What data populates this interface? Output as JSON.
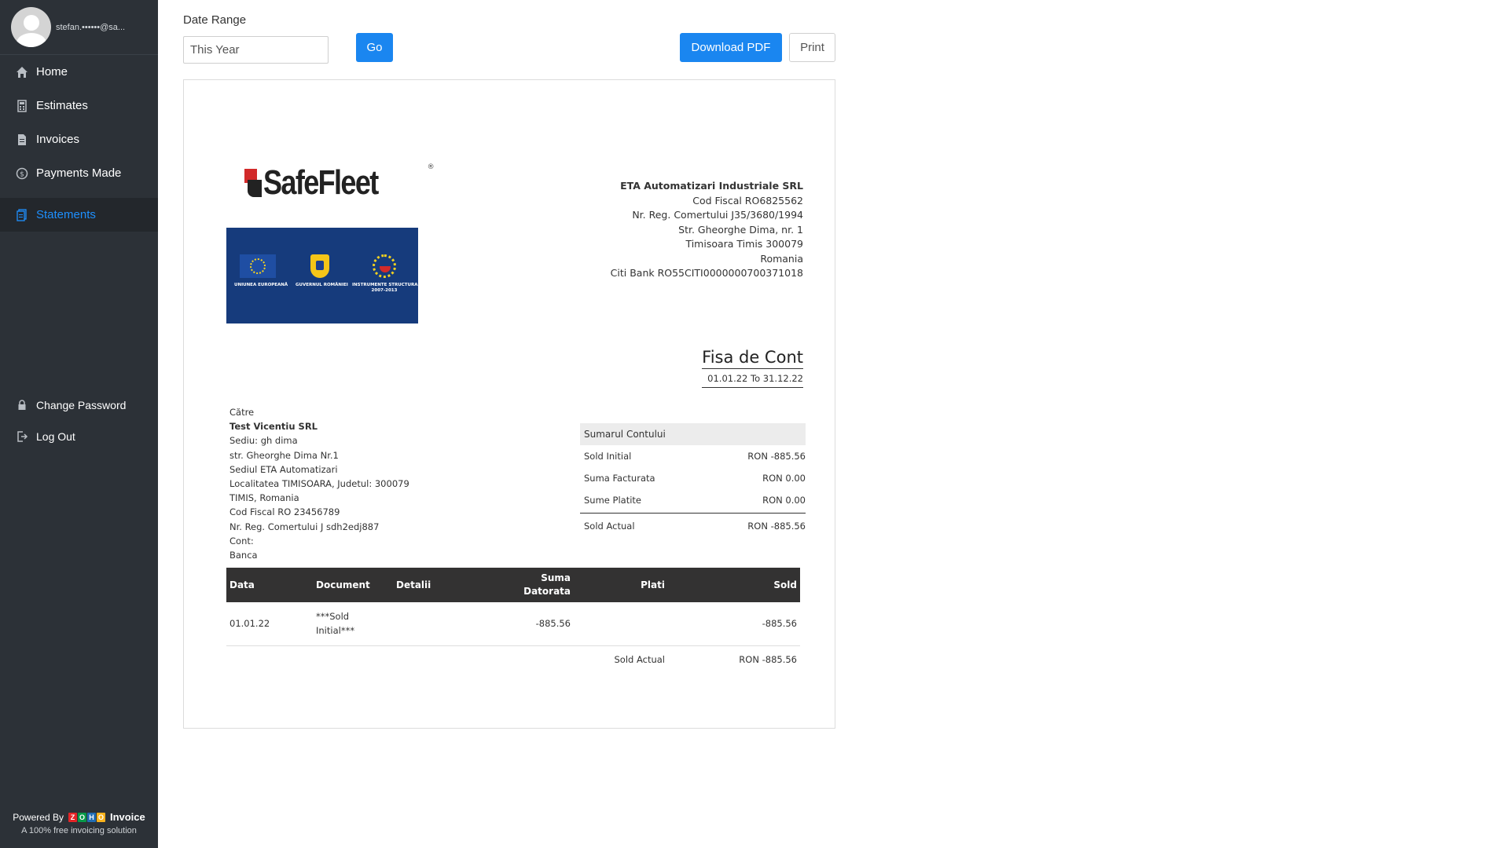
{
  "sidebar": {
    "email": "stefan.••••••@sa...",
    "nav": [
      {
        "label": "Home",
        "icon": "home-icon"
      },
      {
        "label": "Estimates",
        "icon": "calculator-icon"
      },
      {
        "label": "Invoices",
        "icon": "document-icon"
      },
      {
        "label": "Payments Made",
        "icon": "dollar-circle-icon"
      },
      {
        "label": "Statements",
        "icon": "statement-icon",
        "active": true
      }
    ],
    "bottom_nav": [
      {
        "label": "Change Password",
        "icon": "lock-icon"
      },
      {
        "label": "Log Out",
        "icon": "logout-icon"
      }
    ],
    "powered_by": "Powered By",
    "brand": "Invoice",
    "tagline": "A 100% free invoicing solution",
    "zoho_letters": [
      "Z",
      "O",
      "H",
      "O"
    ],
    "zoho_colors": [
      "#e42527",
      "#089949",
      "#226db4",
      "#f9b21d"
    ],
    "active_color": "#1e90ff"
  },
  "toolbar": {
    "date_range_label": "Date Range",
    "date_range_value": "This Year",
    "go_label": "Go",
    "download_label": "Download PDF",
    "print_label": "Print",
    "primary_color": "#1a86f0"
  },
  "statement": {
    "logo_text": "SafeFleet",
    "logo_reg": "®",
    "eu_captions": [
      "UNIUNEA EUROPEANĂ",
      "GUVERNUL ROMÂNIEI",
      "INSTRUMENTE STRUCTURALE",
      "2007-2013"
    ],
    "company": {
      "name": "ETA Automatizari Industriale SRL",
      "lines": [
        "Cod Fiscal RO6825562",
        "Nr. Reg. Comertului J35/3680/1994",
        "Str. Gheorghe Dima, nr. 1",
        "Timisoara Timis 300079",
        "Romania",
        "Citi Bank RO55CITI0000000700371018"
      ]
    },
    "title": "Fisa de Cont",
    "period": "01.01.22 To 31.12.22",
    "to": {
      "label": "Către",
      "company": "Test Vicentiu SRL",
      "lines": [
        "Sediu: gh dima",
        "str. Gheorghe Dima Nr.1",
        "Sediul ETA Automatizari",
        "Localitatea TIMISOARA, Judetul: 300079",
        "TIMIS, Romania",
        "Cod Fiscal RO 23456789",
        "Nr. Reg. Comertului J sdh2edj887",
        "Cont:",
        "Banca"
      ]
    },
    "summary": {
      "heading": "Sumarul Contului",
      "rows": [
        {
          "label": "Sold Initial",
          "value": "RON -885.56"
        },
        {
          "label": "Suma Facturata",
          "value": "RON 0.00"
        },
        {
          "label": "Sume Platite",
          "value": "RON 0.00"
        }
      ],
      "total_label": "Sold Actual",
      "total_value": "RON -885.56"
    },
    "table": {
      "headers": {
        "data": "Data",
        "document": "Document",
        "detalii": "Detalii",
        "suma_line1": "Suma",
        "suma_line2": "Datorata",
        "plati": "Plati",
        "sold": "Sold"
      },
      "rows": [
        {
          "data": "01.01.22",
          "document_line1": "***Sold",
          "document_line2": "Initial***",
          "detalii": "",
          "suma": "-885.56",
          "plati": "",
          "sold": "-885.56"
        }
      ],
      "total_label": "Sold Actual",
      "total_value": "RON -885.56"
    }
  }
}
